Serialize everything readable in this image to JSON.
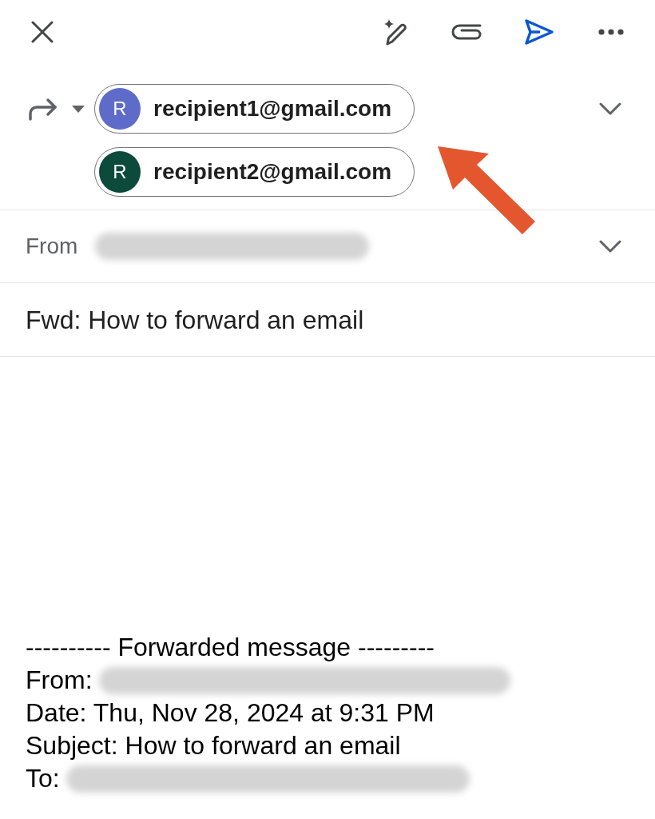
{
  "recipients": {
    "expanded": false,
    "chips": [
      {
        "initial": "R",
        "email": "recipient1@gmail.com",
        "color": "#5f6bc8"
      },
      {
        "initial": "R",
        "email": "recipient2@gmail.com",
        "color": "#0c4a3b"
      }
    ]
  },
  "from": {
    "label": "From",
    "value_redacted": true,
    "expanded": false
  },
  "subject": {
    "value": "Fwd: How to forward an email"
  },
  "forwarded": {
    "header": "---------- Forwarded message ---------",
    "lines": [
      {
        "text": "From:",
        "redacted": true
      },
      {
        "text": "Date: Thu, Nov 28, 2024 at 9:31 PM",
        "redacted": false
      },
      {
        "text": "Subject: How to forward an email",
        "redacted": false
      },
      {
        "text": "To:",
        "redacted": true
      }
    ]
  }
}
